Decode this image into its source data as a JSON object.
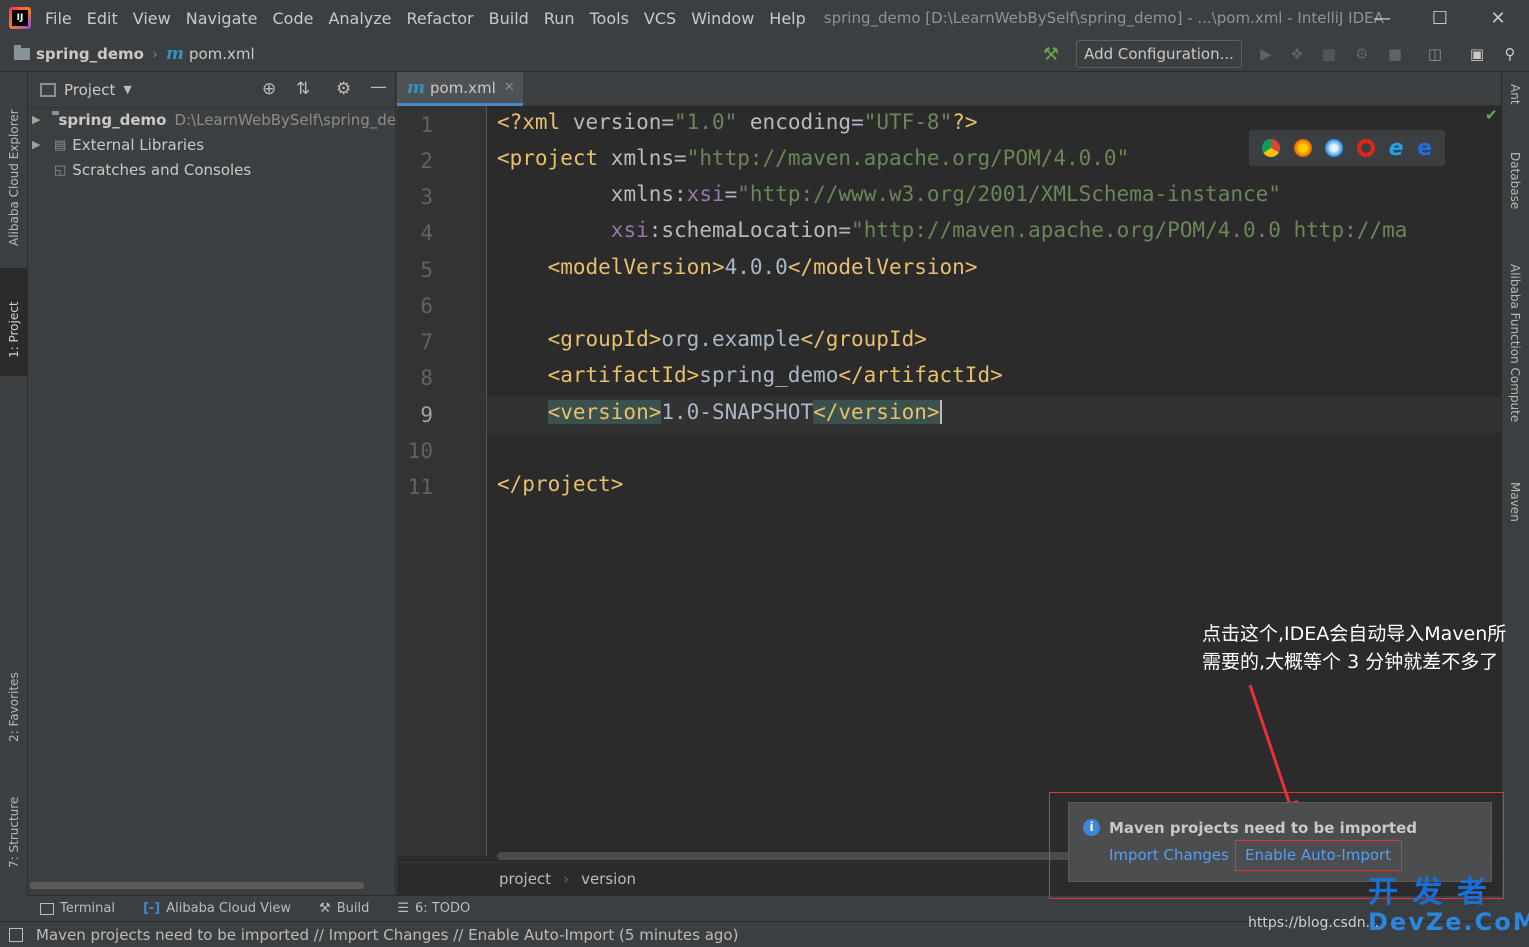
{
  "menubar": {
    "items": [
      "File",
      "Edit",
      "View",
      "Navigate",
      "Code",
      "Analyze",
      "Refactor",
      "Build",
      "Run",
      "Tools",
      "VCS",
      "Window",
      "Help"
    ],
    "window_title": "spring_demo [D:\\LearnWebBySelf\\spring_demo] - ...\\pom.xml - IntelliJ IDEA"
  },
  "navbar": {
    "project": "spring_demo",
    "file": "pom.xml",
    "add_configuration": "Add Configuration..."
  },
  "left_tabs": [
    "Alibaba Cloud Explorer",
    "1: Project",
    "2: Favorites",
    "7: Structure"
  ],
  "right_tabs": [
    "Ant",
    "Database",
    "Alibaba Function Compute",
    "Maven"
  ],
  "project_panel": {
    "title": "Project",
    "tree": [
      {
        "label": "spring_demo",
        "path": "D:\\LearnWebBySelf\\spring_de"
      },
      {
        "label": "External Libraries"
      },
      {
        "label": "Scratches and Consoles"
      }
    ]
  },
  "editor": {
    "tab": "pom.xml",
    "line_numbers": [
      "1",
      "2",
      "3",
      "4",
      "5",
      "6",
      "7",
      "8",
      "9",
      "10",
      "11"
    ],
    "lines": [
      "<?xml version=\"1.0\" encoding=\"UTF-8\"?>",
      "<project xmlns=\"http://maven.apache.org/POM/4.0.0\"",
      "         xmlns:xsi=\"http://www.w3.org/2001/XMLSchema-instance\"",
      "         xsi:schemaLocation=\"http://maven.apache.org/POM/4.0.0 http://ma",
      "    <modelVersion>4.0.0</modelVersion>",
      "",
      "    <groupId>org.example</groupId>",
      "    <artifactId>spring_demo</artifactId>",
      "    <version>1.0-SNAPSHOT</version>",
      "",
      "</project>"
    ],
    "breadcrumbs": [
      "project",
      "version"
    ]
  },
  "bottom_tools": [
    "Terminal",
    "Alibaba Cloud View",
    "Build",
    "6: TODO"
  ],
  "status_message": "Maven projects need to be imported // Import Changes // Enable Auto-Import (5 minutes ago)",
  "notification": {
    "title": "Maven projects need to be imported",
    "import_changes": "Import Changes",
    "enable_auto_import": "Enable Auto-Import"
  },
  "annotation": {
    "line1": "点击这个,IDEA会自动导入Maven所",
    "line2": "需要的,大概等个 3 分钟就差不多了"
  },
  "watermark": {
    "logo": "开 发 者\nDevZe.CoM",
    "csdn": "https://blog.csdn..."
  },
  "colors": {
    "accent": "#589df6",
    "highlight_red": "#e6313b",
    "editor_bg": "#2b2b2b"
  }
}
